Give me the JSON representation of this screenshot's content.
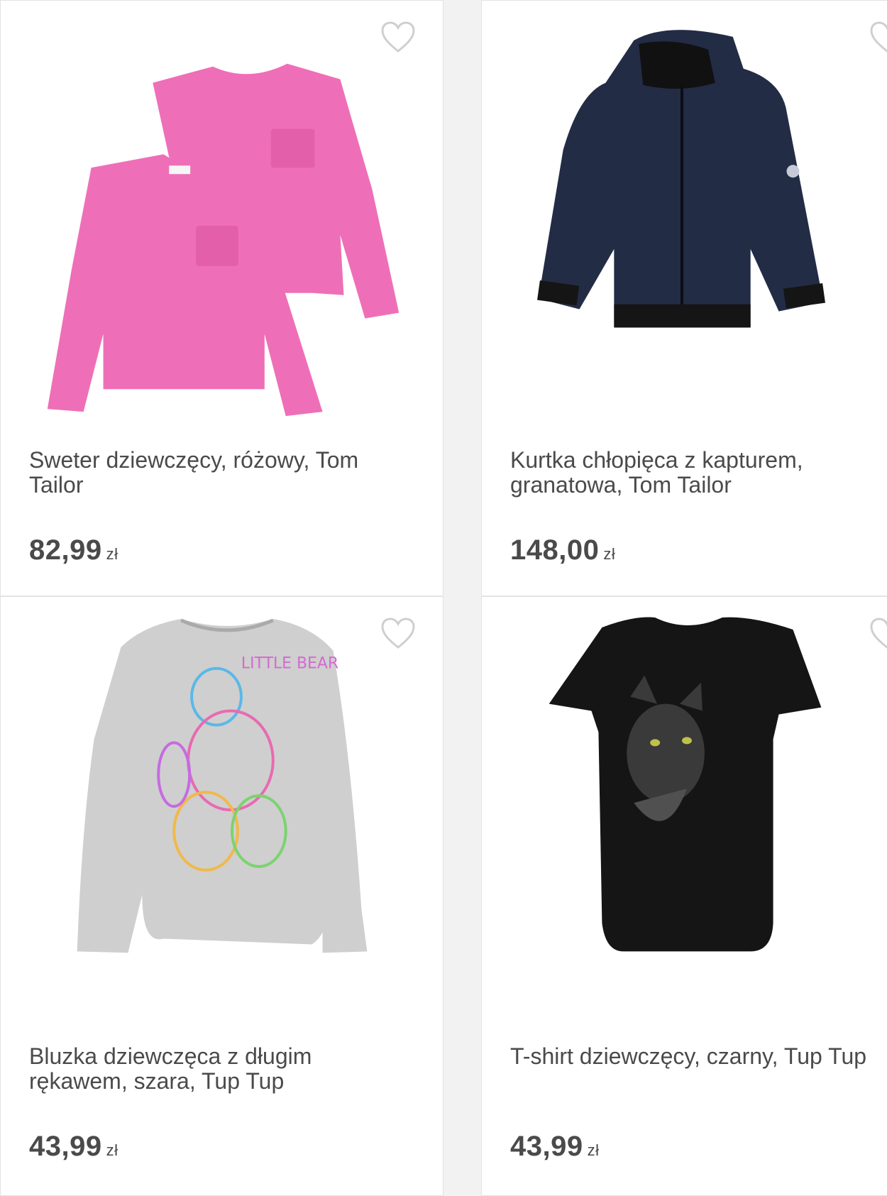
{
  "products": [
    {
      "title": "Sweter dziewczęcy, różowy, Tom Tailor",
      "price": "82,99",
      "currency": "zł",
      "image": "pink-sweater-icon",
      "color": "#ee6fb7"
    },
    {
      "title": "Kurtka chłopięca z kapturem, granatowa, Tom Tailor",
      "price": "148,00",
      "currency": "zł",
      "image": "navy-jacket-icon",
      "color": "#232c45"
    },
    {
      "title": "Bluzka dziewczęca z długim rękawem, szara, Tup Tup",
      "price": "43,99",
      "currency": "zł",
      "image": "grey-longsleeve-icon",
      "color": "#cfcfcf"
    },
    {
      "title": "T-shirt dziewczęcy, czarny, Tup Tup",
      "price": "43,99",
      "currency": "zł",
      "image": "black-tshirt-icon",
      "color": "#151515"
    }
  ],
  "icons": {
    "favorite": "heart-outline-icon"
  }
}
